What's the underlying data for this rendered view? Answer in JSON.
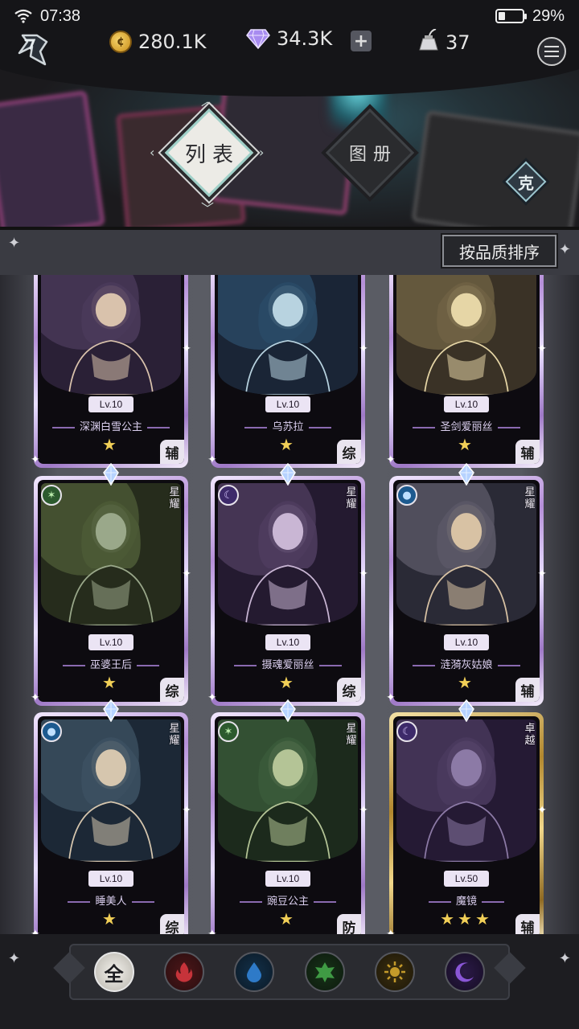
{
  "status_bar": {
    "time": "07:38",
    "battery": "29%",
    "battery_level": 0.29
  },
  "resources": {
    "gold": "280.1K",
    "gems": "34.3K",
    "energy": "37"
  },
  "tabs": {
    "list": "列表",
    "album": "图册"
  },
  "counter_button": "克",
  "sort_button": "按品质排序",
  "cards": [
    {
      "level": "Lv.10",
      "name": "深渊白雪公主",
      "stars": "★",
      "role": "辅",
      "rank": "",
      "element": "",
      "frame": "purple",
      "art": [
        "#4a3a5a",
        "#2a2036",
        "#d9c2ac"
      ]
    },
    {
      "level": "Lv.10",
      "name": "乌苏拉",
      "stars": "★",
      "role": "综",
      "rank": "",
      "element": "",
      "frame": "purple",
      "art": [
        "#2a4a66",
        "#1a2536",
        "#b8d3e0"
      ]
    },
    {
      "level": "Lv.10",
      "name": "圣剑爱丽丝",
      "stars": "★",
      "role": "辅",
      "rank": "",
      "element": "",
      "frame": "purple",
      "art": [
        "#6f6244",
        "#3a3226",
        "#e6d6a6"
      ]
    },
    {
      "level": "Lv.10",
      "name": "巫婆王后",
      "stars": "★",
      "role": "综",
      "rank": "星耀",
      "element": "wood",
      "frame": "purple",
      "art": [
        "#4c5a36",
        "#262c1c",
        "#9aa88a"
      ]
    },
    {
      "level": "Lv.10",
      "name": "摄魂爱丽丝",
      "stars": "★",
      "role": "综",
      "rank": "星耀",
      "element": "moon",
      "frame": "purple",
      "art": [
        "#4e3c5e",
        "#241a30",
        "#c9b6d4"
      ]
    },
    {
      "level": "Lv.10",
      "name": "涟漪灰姑娘",
      "stars": "★",
      "role": "辅",
      "rank": "星耀",
      "element": "water",
      "frame": "purple",
      "art": [
        "#5a5866",
        "#2a2a36",
        "#d8c2a4"
      ]
    },
    {
      "level": "Lv.10",
      "name": "睡美人",
      "stars": "★",
      "role": "综",
      "rank": "星耀",
      "element": "water",
      "frame": "purple",
      "art": [
        "#3c5062",
        "#1c2836",
        "#d6c6ae"
      ]
    },
    {
      "level": "Lv.10",
      "name": "豌豆公主",
      "stars": "★",
      "role": "防",
      "rank": "星耀",
      "element": "wood",
      "frame": "purple",
      "art": [
        "#3a5a3a",
        "#1c2a1c",
        "#b4c496"
      ]
    },
    {
      "level": "Lv.50",
      "name": "魔镜",
      "stars": "★★★",
      "role": "辅",
      "rank": "卓越",
      "element": "moon",
      "frame": "gold",
      "art": [
        "#4a3a5e",
        "#251a34",
        "#8c7aa6"
      ]
    }
  ],
  "filters": [
    {
      "name": "all",
      "label": "全"
    },
    {
      "name": "fire",
      "label": "火"
    },
    {
      "name": "water",
      "label": "水"
    },
    {
      "name": "wood",
      "label": "木"
    },
    {
      "name": "sun",
      "label": "光"
    },
    {
      "name": "moon",
      "label": "暗"
    }
  ],
  "icons": {
    "back": "back-arrow-icon",
    "gold": "gold-coin-icon",
    "gem": "diamond-icon",
    "energy": "ink-bottle-icon",
    "menu": "menu-icon"
  }
}
